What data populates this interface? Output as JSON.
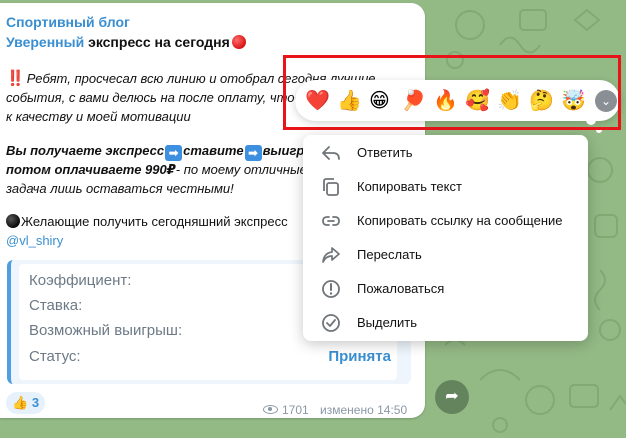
{
  "post": {
    "channel": "Спортивный блог",
    "title_blue": "Уверенный",
    "title_rest": " экспресс на сегодня",
    "bangs": "‼️",
    "line1": "Ребят, просчесал всю линию и отобрал сегодня лучшие",
    "line2": "события, с вами делюсь на после оплату, чтоб",
    "line3": "к качеству и моей мотивации",
    "line4a": "Вы получаете экспресс",
    "line4b": "ставите",
    "line4c": "выигрыв",
    "line5a": "потом оплачиваете 990₽",
    "line5b": "- по моему отличные",
    "line6": "задача лишь оставаться честными!",
    "line7": "Желающие получить сегодняшний экспресс",
    "handle": "@vl_shiry",
    "arrow": "➡"
  },
  "card": {
    "coef_label": "Коэффициент:",
    "stake_label": "Ставка:",
    "win_label": "Возможный выигрыш:",
    "status_label": "Статус:",
    "status_value": "Принята"
  },
  "footer": {
    "reaction_emoji": "👍",
    "reaction_count": "3",
    "views": "1701",
    "edited": "изменено 14:50"
  },
  "reactions": [
    "❤️",
    "👍",
    "😁",
    "🏓",
    "🔥",
    "🥰",
    "👏",
    "🤔",
    "🤯"
  ],
  "menu": {
    "reply": "Ответить",
    "copy_text": "Копировать текст",
    "copy_link": "Копировать ссылку на сообщение",
    "forward": "Переслать",
    "report": "Пожаловаться",
    "select": "Выделить"
  },
  "colors": {
    "accent": "#3a8fd0",
    "highlight": "#e8141a",
    "chat_bg": "#93b985"
  }
}
